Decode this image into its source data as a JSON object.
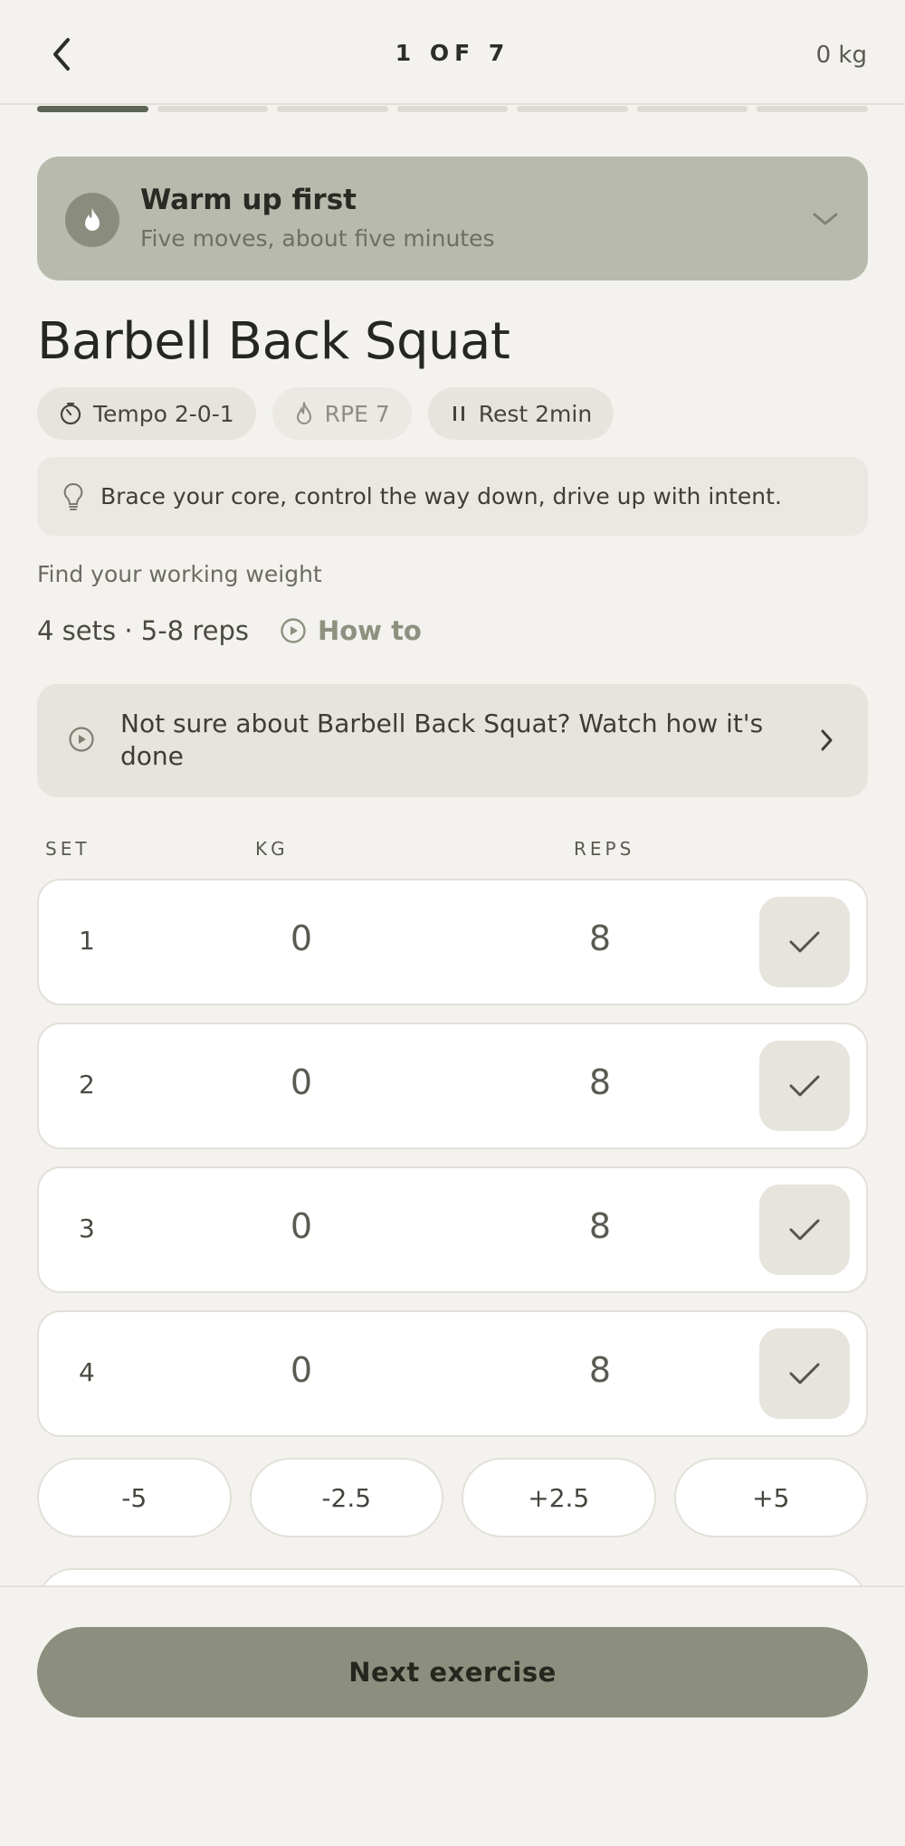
{
  "header": {
    "back_icon": "chevron-left-icon",
    "step_counter": "1 OF 7",
    "total_weight": "0 kg"
  },
  "progress": {
    "current_step": 1,
    "total_steps": 7
  },
  "warmup": {
    "icon": "flame-icon",
    "title": "Warm up first",
    "subtitle": "Five moves, about five minutes",
    "chevron_icon": "chevron-down-icon"
  },
  "exercise": {
    "title": "Barbell Back Squat",
    "chips": {
      "tempo": {
        "icon": "timer-icon",
        "label": "Tempo 2-0-1"
      },
      "rpe": {
        "icon": "flame-outline-icon",
        "label": "RPE 7"
      },
      "rest": {
        "icon": "pause-icon",
        "label": "Rest 2min"
      }
    },
    "tip": {
      "icon": "lightbulb-icon",
      "text": "Brace your core, control the way down, drive up with intent."
    },
    "find_weight": "Find your working weight",
    "sets_summary": "4 sets · 5-8 reps",
    "how_to": {
      "icon": "play-circle-icon",
      "label": "How to"
    },
    "watch": {
      "icon": "play-circle-icon",
      "text": "Not sure about Barbell Back Squat? Watch how it's done",
      "chevron_icon": "chevron-right-icon"
    }
  },
  "table": {
    "headers": {
      "set": "SET",
      "kg": "KG",
      "reps": "REPS"
    },
    "rows": [
      {
        "set": "1",
        "kg": "0",
        "reps": "8",
        "done": false
      },
      {
        "set": "2",
        "kg": "0",
        "reps": "8",
        "done": false
      },
      {
        "set": "3",
        "kg": "0",
        "reps": "8",
        "done": false
      },
      {
        "set": "4",
        "kg": "0",
        "reps": "8",
        "done": false
      }
    ]
  },
  "adjusters": [
    "-5",
    "-2.5",
    "+2.5",
    "+5"
  ],
  "footer": {
    "next_label": "Next exercise"
  },
  "colors": {
    "background": "#f3f2ee",
    "accent": "#8c8f7d",
    "warmup_banner": "#b7baad",
    "progress_active": "#5e6558"
  }
}
